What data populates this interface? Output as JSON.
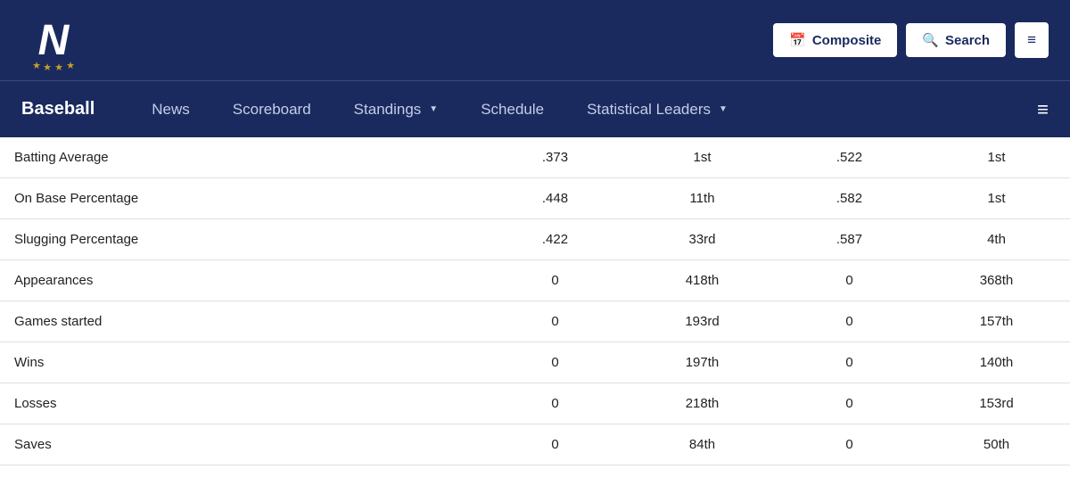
{
  "header": {
    "composite_label": "Composite",
    "search_label": "Search",
    "menu_label": "≡"
  },
  "nav": {
    "sport_title": "Baseball",
    "items": [
      {
        "label": "News",
        "has_dropdown": false
      },
      {
        "label": "Scoreboard",
        "has_dropdown": false
      },
      {
        "label": "Standings",
        "has_dropdown": true
      },
      {
        "label": "Schedule",
        "has_dropdown": false
      },
      {
        "label": "Statistical Leaders",
        "has_dropdown": true
      }
    ]
  },
  "table": {
    "rows": [
      {
        "stat": "Batting Average",
        "val1": ".373",
        "rank1": "1st",
        "val2": ".522",
        "rank2": "1st"
      },
      {
        "stat": "On Base Percentage",
        "val1": ".448",
        "rank1": "11th",
        "val2": ".582",
        "rank2": "1st"
      },
      {
        "stat": "Slugging Percentage",
        "val1": ".422",
        "rank1": "33rd",
        "val2": ".587",
        "rank2": "4th"
      },
      {
        "stat": "Appearances",
        "val1": "0",
        "rank1": "418th",
        "val2": "0",
        "rank2": "368th"
      },
      {
        "stat": "Games started",
        "val1": "0",
        "rank1": "193rd",
        "val2": "0",
        "rank2": "157th"
      },
      {
        "stat": "Wins",
        "val1": "0",
        "rank1": "197th",
        "val2": "0",
        "rank2": "140th"
      },
      {
        "stat": "Losses",
        "val1": "0",
        "rank1": "218th",
        "val2": "0",
        "rank2": "153rd"
      },
      {
        "stat": "Saves",
        "val1": "0",
        "rank1": "84th",
        "val2": "0",
        "rank2": "50th"
      }
    ]
  }
}
